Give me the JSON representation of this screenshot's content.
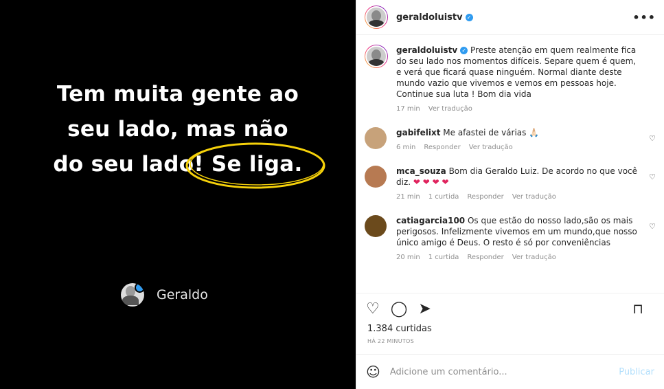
{
  "post": {
    "quote_line1": "Tem muita gente ao",
    "quote_line2": "seu lado, mas não",
    "quote_line3a": "do seu lado",
    "quote_line3b": "! Se liga.",
    "author": "Geraldo"
  },
  "header": {
    "username": "geraldoluistv",
    "more": "•••"
  },
  "caption": {
    "username": "geraldoluistv",
    "text": "Preste atenção em quem realmente fica do seu lado nos momentos difíceis. Separe quem é quem, e verá que ficará quase ninguém. Normal diante deste mundo vazio que vivemos e vemos em pessoas hoje. Continue sua luta ! Bom dia vida",
    "time": "17 min",
    "translate": "Ver tradução"
  },
  "comments": [
    {
      "username": "gabifelixt",
      "text": "Me afastei de várias 🙏🏻",
      "time": "6 min",
      "likes": "",
      "reply": "Responder",
      "translate": "Ver tradução",
      "avatar_color": "#c7a27a"
    },
    {
      "username": "mca_souza",
      "text": "Bom dia Geraldo Luiz. De acordo no que você diz.",
      "hearts": "❤ ❤ ❤ ❤",
      "time": "21 min",
      "likes": "1 curtida",
      "reply": "Responder",
      "translate": "Ver tradução",
      "avatar_color": "#b77a52"
    },
    {
      "username": "catiagarcia100",
      "text": "Os que estão do nosso lado,são os mais perigosos. Infelizmente vivemos em um mundo,que nosso único amigo é Deus. O resto é só por conveniências",
      "time": "20 min",
      "likes": "1 curtida",
      "reply": "Responder",
      "translate": "Ver tradução",
      "avatar_color": "#6b4a1c"
    }
  ],
  "actions": {
    "like_icon": "♡",
    "comment_icon": "◯",
    "share_icon": "➤",
    "save_icon": "⊓"
  },
  "likes": "1.384 curtidas",
  "time_ago": "HÁ 22 MINUTOS",
  "add_comment": {
    "placeholder": "Adicione um comentário...",
    "publish": "Publicar",
    "emoji_icon": "☺"
  },
  "colors": {
    "accent": "#0095f6",
    "verified": "#2f9bf0",
    "highlight": "#f5d10a"
  }
}
